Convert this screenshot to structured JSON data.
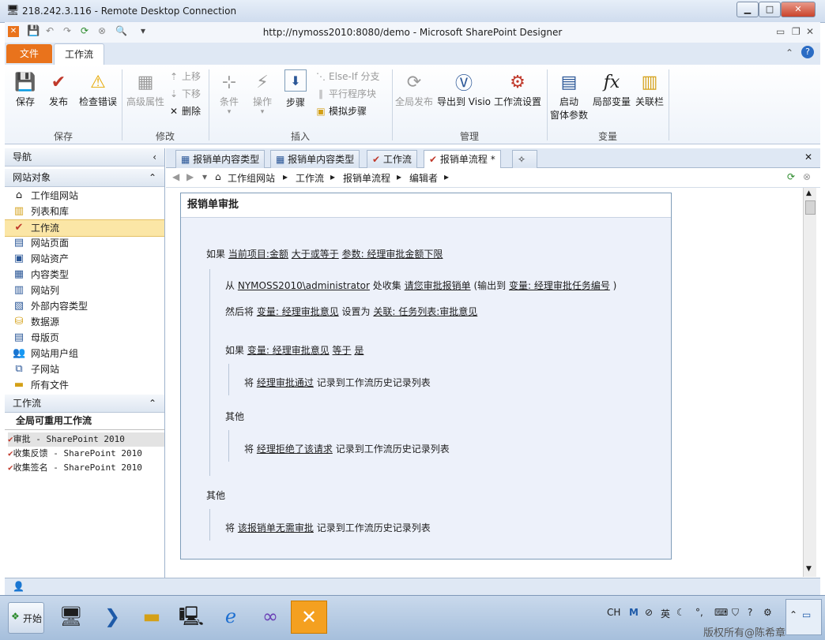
{
  "rdp": {
    "title": "218.242.3.116 - Remote Desktop Connection",
    "min": "▁",
    "max": "□",
    "close": "✕"
  },
  "app": {
    "title": "http://nymoss2010:8080/demo - Microsoft SharePoint Designer"
  },
  "tabs": {
    "file": "文件",
    "workflow": "工作流"
  },
  "ribbon": {
    "save": {
      "save": "保存",
      "publish": "发布",
      "check": "检查错误",
      "group": "保存"
    },
    "modify": {
      "advanced": "高级属性",
      "up": "上移",
      "down": "下移",
      "delete": "删除",
      "group": "修改"
    },
    "insert": {
      "condition": "条件",
      "action": "操作",
      "step": "步骤",
      "elseif": "Else-If 分支",
      "parallel": "平行程序块",
      "impersonation": "模拟步骤",
      "group": "插入"
    },
    "manage": {
      "global_publish": "全局发布",
      "export_visio": "导出到 Visio",
      "settings": "工作流设置",
      "group": "管理"
    },
    "variables": {
      "init_line1": "启动",
      "init_line2": "窗体参数",
      "local": "局部变量",
      "assoc": "关联栏",
      "group": "变量"
    }
  },
  "nav": {
    "title": "导航",
    "section": "网站对象",
    "items": [
      "工作组网站",
      "列表和库",
      "工作流",
      "网站页面",
      "网站资产",
      "内容类型",
      "网站列",
      "外部内容类型",
      "数据源",
      "母版页",
      "网站用户组",
      "子网站",
      "所有文件"
    ],
    "wf_section": "工作流",
    "global_title": "全局可重用工作流",
    "global_items": [
      "审批 - SharePoint 2010",
      "收集反馈 - SharePoint 2010",
      "收集签名 - SharePoint 2010"
    ]
  },
  "doc_tabs": [
    "报销单内容类型",
    "报销单内容类型",
    "工作流",
    "报销单流程 *"
  ],
  "breadcrumb": [
    "工作组网站",
    "工作流",
    "报销单流程",
    "编辑者"
  ],
  "workflow": {
    "step_title": "报销单审批",
    "if1": {
      "kw": "如果",
      "field": "当前项目:金额",
      "op": "大于或等于",
      "value": "参数: 经理审批金额下限"
    },
    "task": {
      "from": "从",
      "user": "NYMOSS2010\\administrator",
      "collect": "处收集",
      "data": "请您审批报销单",
      "out_open": "(输出到",
      "out_var": "变量: 经理审批任务编号",
      "out_close": ")"
    },
    "set": {
      "kw": "然后将",
      "var": "变量: 经理审批意见",
      "to": "设置为",
      "val": "关联: 任务列表:审批意见"
    },
    "if2": {
      "kw": "如果",
      "var": "变量: 经理审批意见",
      "op": "等于",
      "val": "是"
    },
    "log1": {
      "kw": "将",
      "msg": "经理审批通过",
      "tail": "记录到工作流历史记录列表"
    },
    "else1": "其他",
    "log2": {
      "kw": "将",
      "msg": "经理拒绝了该请求",
      "tail": "记录到工作流历史记录列表"
    },
    "else2": "其他",
    "log3": {
      "kw": "将",
      "msg": "该报销单无需审批",
      "tail": "记录到工作流历史记录列表"
    }
  },
  "taskbar": {
    "start": "开始",
    "lang": "CH",
    "ime": "英"
  },
  "watermark": "版权所有@陈希章"
}
